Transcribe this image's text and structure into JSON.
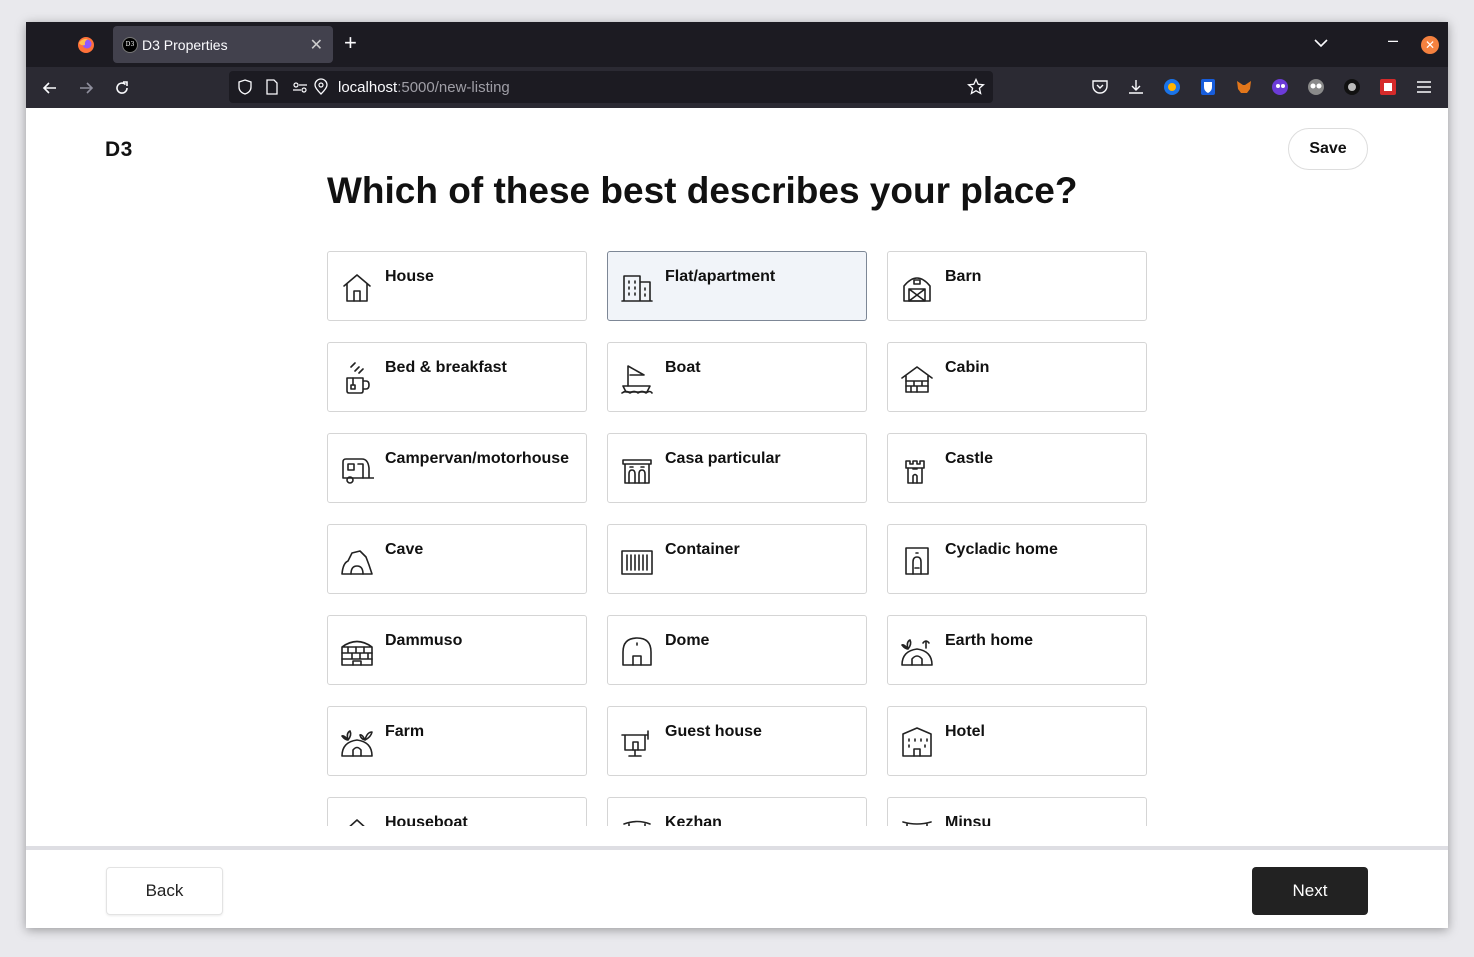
{
  "browser": {
    "tab_title": "D3 Properties",
    "tab_favicon_text": "D3",
    "url_host": "localhost",
    "url_rest": ":5000/new-listing"
  },
  "app": {
    "logo": "D3",
    "save_label": "Save",
    "heading": "Which of these best describes your place?",
    "back_label": "Back",
    "next_label": "Next"
  },
  "property_types": [
    {
      "label": "House",
      "icon": "house-icon",
      "selected": false
    },
    {
      "label": "Flat/apartment",
      "icon": "apartment-icon",
      "selected": true
    },
    {
      "label": "Barn",
      "icon": "barn-icon",
      "selected": false
    },
    {
      "label": "Bed & breakfast",
      "icon": "mug-icon",
      "selected": false
    },
    {
      "label": "Boat",
      "icon": "boat-icon",
      "selected": false
    },
    {
      "label": "Cabin",
      "icon": "cabin-icon",
      "selected": false
    },
    {
      "label": "Campervan/motorhouse",
      "icon": "camper-icon",
      "selected": false
    },
    {
      "label": "Casa particular",
      "icon": "casa-icon",
      "selected": false
    },
    {
      "label": "Castle",
      "icon": "castle-icon",
      "selected": false
    },
    {
      "label": "Cave",
      "icon": "cave-icon",
      "selected": false
    },
    {
      "label": "Container",
      "icon": "container-icon",
      "selected": false
    },
    {
      "label": "Cycladic home",
      "icon": "cycladic-icon",
      "selected": false
    },
    {
      "label": "Dammuso",
      "icon": "dammuso-icon",
      "selected": false
    },
    {
      "label": "Dome",
      "icon": "dome-icon",
      "selected": false
    },
    {
      "label": "Earth home",
      "icon": "earth-home-icon",
      "selected": false
    },
    {
      "label": "Farm",
      "icon": "farm-icon",
      "selected": false
    },
    {
      "label": "Guest house",
      "icon": "guest-house-icon",
      "selected": false
    },
    {
      "label": "Hotel",
      "icon": "hotel-icon",
      "selected": false
    },
    {
      "label": "Houseboat",
      "icon": "houseboat-icon",
      "selected": false
    },
    {
      "label": "Kezhan",
      "icon": "kezhan-icon",
      "selected": false
    },
    {
      "label": "Minsu",
      "icon": "minsu-icon",
      "selected": false
    }
  ]
}
